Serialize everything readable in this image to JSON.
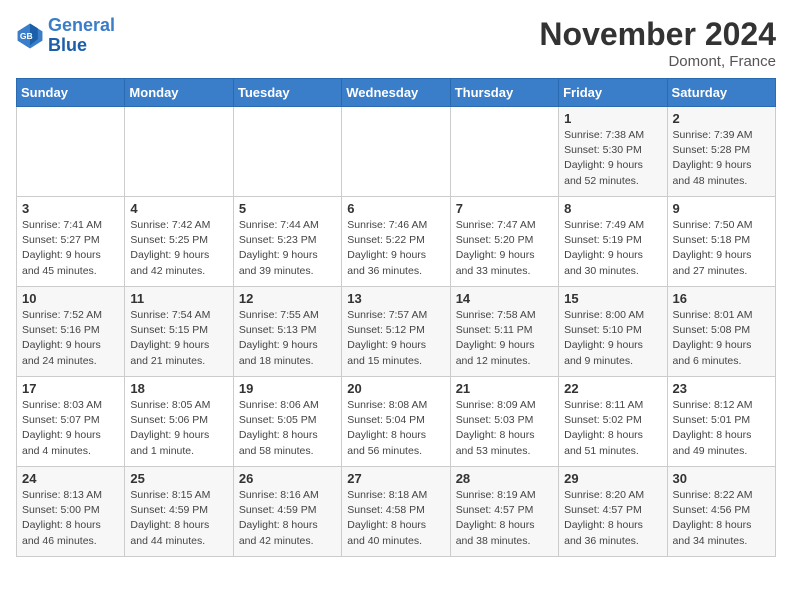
{
  "header": {
    "logo_line1": "General",
    "logo_line2": "Blue",
    "month": "November 2024",
    "location": "Domont, France"
  },
  "days_of_week": [
    "Sunday",
    "Monday",
    "Tuesday",
    "Wednesday",
    "Thursday",
    "Friday",
    "Saturday"
  ],
  "weeks": [
    [
      {
        "day": "",
        "info": ""
      },
      {
        "day": "",
        "info": ""
      },
      {
        "day": "",
        "info": ""
      },
      {
        "day": "",
        "info": ""
      },
      {
        "day": "",
        "info": ""
      },
      {
        "day": "1",
        "info": "Sunrise: 7:38 AM\nSunset: 5:30 PM\nDaylight: 9 hours\nand 52 minutes."
      },
      {
        "day": "2",
        "info": "Sunrise: 7:39 AM\nSunset: 5:28 PM\nDaylight: 9 hours\nand 48 minutes."
      }
    ],
    [
      {
        "day": "3",
        "info": "Sunrise: 7:41 AM\nSunset: 5:27 PM\nDaylight: 9 hours\nand 45 minutes."
      },
      {
        "day": "4",
        "info": "Sunrise: 7:42 AM\nSunset: 5:25 PM\nDaylight: 9 hours\nand 42 minutes."
      },
      {
        "day": "5",
        "info": "Sunrise: 7:44 AM\nSunset: 5:23 PM\nDaylight: 9 hours\nand 39 minutes."
      },
      {
        "day": "6",
        "info": "Sunrise: 7:46 AM\nSunset: 5:22 PM\nDaylight: 9 hours\nand 36 minutes."
      },
      {
        "day": "7",
        "info": "Sunrise: 7:47 AM\nSunset: 5:20 PM\nDaylight: 9 hours\nand 33 minutes."
      },
      {
        "day": "8",
        "info": "Sunrise: 7:49 AM\nSunset: 5:19 PM\nDaylight: 9 hours\nand 30 minutes."
      },
      {
        "day": "9",
        "info": "Sunrise: 7:50 AM\nSunset: 5:18 PM\nDaylight: 9 hours\nand 27 minutes."
      }
    ],
    [
      {
        "day": "10",
        "info": "Sunrise: 7:52 AM\nSunset: 5:16 PM\nDaylight: 9 hours\nand 24 minutes."
      },
      {
        "day": "11",
        "info": "Sunrise: 7:54 AM\nSunset: 5:15 PM\nDaylight: 9 hours\nand 21 minutes."
      },
      {
        "day": "12",
        "info": "Sunrise: 7:55 AM\nSunset: 5:13 PM\nDaylight: 9 hours\nand 18 minutes."
      },
      {
        "day": "13",
        "info": "Sunrise: 7:57 AM\nSunset: 5:12 PM\nDaylight: 9 hours\nand 15 minutes."
      },
      {
        "day": "14",
        "info": "Sunrise: 7:58 AM\nSunset: 5:11 PM\nDaylight: 9 hours\nand 12 minutes."
      },
      {
        "day": "15",
        "info": "Sunrise: 8:00 AM\nSunset: 5:10 PM\nDaylight: 9 hours\nand 9 minutes."
      },
      {
        "day": "16",
        "info": "Sunrise: 8:01 AM\nSunset: 5:08 PM\nDaylight: 9 hours\nand 6 minutes."
      }
    ],
    [
      {
        "day": "17",
        "info": "Sunrise: 8:03 AM\nSunset: 5:07 PM\nDaylight: 9 hours\nand 4 minutes."
      },
      {
        "day": "18",
        "info": "Sunrise: 8:05 AM\nSunset: 5:06 PM\nDaylight: 9 hours\nand 1 minute."
      },
      {
        "day": "19",
        "info": "Sunrise: 8:06 AM\nSunset: 5:05 PM\nDaylight: 8 hours\nand 58 minutes."
      },
      {
        "day": "20",
        "info": "Sunrise: 8:08 AM\nSunset: 5:04 PM\nDaylight: 8 hours\nand 56 minutes."
      },
      {
        "day": "21",
        "info": "Sunrise: 8:09 AM\nSunset: 5:03 PM\nDaylight: 8 hours\nand 53 minutes."
      },
      {
        "day": "22",
        "info": "Sunrise: 8:11 AM\nSunset: 5:02 PM\nDaylight: 8 hours\nand 51 minutes."
      },
      {
        "day": "23",
        "info": "Sunrise: 8:12 AM\nSunset: 5:01 PM\nDaylight: 8 hours\nand 49 minutes."
      }
    ],
    [
      {
        "day": "24",
        "info": "Sunrise: 8:13 AM\nSunset: 5:00 PM\nDaylight: 8 hours\nand 46 minutes."
      },
      {
        "day": "25",
        "info": "Sunrise: 8:15 AM\nSunset: 4:59 PM\nDaylight: 8 hours\nand 44 minutes."
      },
      {
        "day": "26",
        "info": "Sunrise: 8:16 AM\nSunset: 4:59 PM\nDaylight: 8 hours\nand 42 minutes."
      },
      {
        "day": "27",
        "info": "Sunrise: 8:18 AM\nSunset: 4:58 PM\nDaylight: 8 hours\nand 40 minutes."
      },
      {
        "day": "28",
        "info": "Sunrise: 8:19 AM\nSunset: 4:57 PM\nDaylight: 8 hours\nand 38 minutes."
      },
      {
        "day": "29",
        "info": "Sunrise: 8:20 AM\nSunset: 4:57 PM\nDaylight: 8 hours\nand 36 minutes."
      },
      {
        "day": "30",
        "info": "Sunrise: 8:22 AM\nSunset: 4:56 PM\nDaylight: 8 hours\nand 34 minutes."
      }
    ]
  ]
}
